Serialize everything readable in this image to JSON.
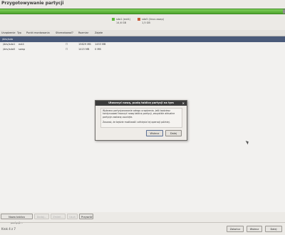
{
  "window": {
    "title": "Przygotowywanie partycji"
  },
  "partition_bar": {
    "segments": [
      {
        "name": "sda1 (ext4)",
        "size": "14,6 GB",
        "color": "#5fba3d",
        "fraction": 0.99
      },
      {
        "name": "sda5 (linux-swap)",
        "size": "1,5 GB",
        "color": "#8e8e8e",
        "fraction": 0.01
      }
    ]
  },
  "table": {
    "headers": [
      "Urządzenie",
      "Typ",
      "Punkt montowania",
      "Sformatować?",
      "Rozmiar",
      "Zajęte"
    ],
    "selected_row": "/dev/sda",
    "rows": [
      {
        "device": "/dev/sda1",
        "type": "ext4",
        "mount": "",
        "format": "☐",
        "size": "15629 MB",
        "used": "1453 MB"
      },
      {
        "device": "/dev/sda5",
        "type": "swap",
        "mount": "",
        "format": "☐",
        "size": "1415 MB",
        "used": "0 MB"
      }
    ]
  },
  "buttons": {
    "new_table": "Nowa tablica partycji...",
    "add": "Dodaj...",
    "change": "Zmień...",
    "delete": "Usuń",
    "revert": "Przywróć"
  },
  "footer": {
    "step": "Krok 4 z 7",
    "quit": "Zakończ",
    "back": "Wstecz",
    "forward": "Dalej"
  },
  "dialog": {
    "title": "Utworzyć nową, pustą tablicę partycji na tym",
    "close": "×",
    "text1": "Wybrano partycjonowanie całego urządzenia. Jeśli będziesz kontynuować tworzyć nową tablicę partycji, wszystkie aktualne partycje zostaną usunięte.",
    "text2": "Zauważ, że będzie możliwość cofnięcia tej operacji później.",
    "continue": "Wstecz",
    "cancel": "Dalej"
  }
}
